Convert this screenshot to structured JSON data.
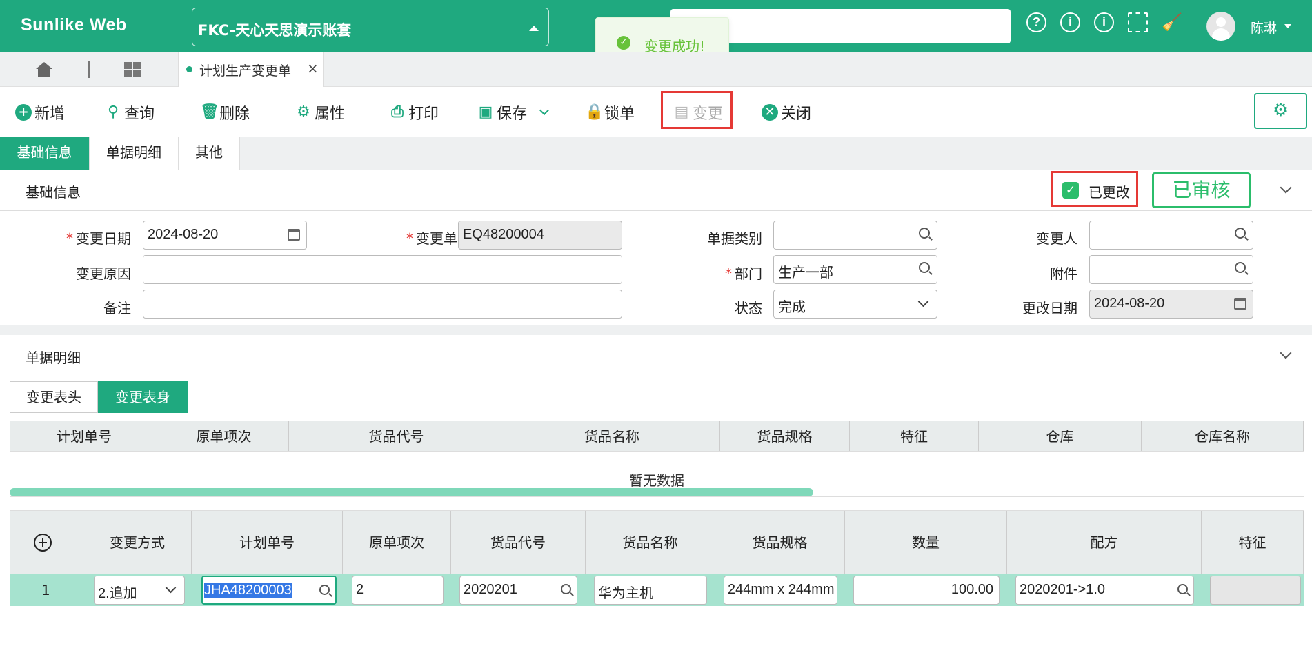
{
  "header": {
    "logo": "Sunlike Web",
    "account": "FKC-天心天思演示账套",
    "user": "陈琳",
    "icons": [
      "help-icon",
      "info-icon",
      "info-icon",
      "fullscreen-icon",
      "broom-icon"
    ]
  },
  "toast": {
    "message": "变更成功!"
  },
  "tabs": {
    "doc_tab": "计划生产变更单",
    "close": "×"
  },
  "toolbar": {
    "add": "新增",
    "query": "查询",
    "delete": "删除",
    "properties": "属性",
    "print": "打印",
    "save": "保存",
    "lock": "锁单",
    "change": "变更",
    "close": "关闭"
  },
  "subtabs": [
    "基础信息",
    "单据明细",
    "其他"
  ],
  "basic": {
    "section_title": "基础信息",
    "changed_label": "已更改",
    "changed_checked": true,
    "audit_stamp": "已审核",
    "fields": {
      "change_date_label": "变更日期",
      "change_date": "2024-08-20",
      "change_no_label": "变更单号",
      "change_no": "EQ48200004",
      "doc_type_label": "单据类别",
      "doc_type": "",
      "changer_label": "变更人",
      "changer": "",
      "reason_label": "变更原因",
      "reason": "",
      "dept_label": "部门",
      "dept": "生产一部",
      "attachment_label": "附件",
      "attachment": "",
      "remark_label": "备注",
      "remark": "",
      "status_label": "状态",
      "status": "完成",
      "modify_date_label": "更改日期",
      "modify_date": "2024-08-20"
    }
  },
  "detail": {
    "section_title": "单据明细",
    "tabs": [
      "变更表头",
      "变更表身"
    ],
    "grid1_columns": [
      "计划单号",
      "原单项次",
      "货品代号",
      "货品名称",
      "货品规格",
      "特征",
      "仓库",
      "仓库名称"
    ],
    "grid1_empty": "暂无数据",
    "grid2_columns": [
      "变更方式",
      "计划单号",
      "原单项次",
      "货品代号",
      "货品名称",
      "货品规格",
      "数量",
      "配方",
      "特征"
    ],
    "rows": [
      {
        "num": "1",
        "change_mode": "2.追加",
        "plan_no": "JHA48200003",
        "orig_item": "2",
        "item_code": "2020201",
        "item_name": "华为主机",
        "item_spec": "244mm x 244mm",
        "qty": "100.00",
        "formula": "2020201->1.0",
        "feature": ""
      }
    ]
  },
  "colors": {
    "brand": "#1fa97f",
    "highlight": "#e53935",
    "audit": "#2bbd6b"
  }
}
